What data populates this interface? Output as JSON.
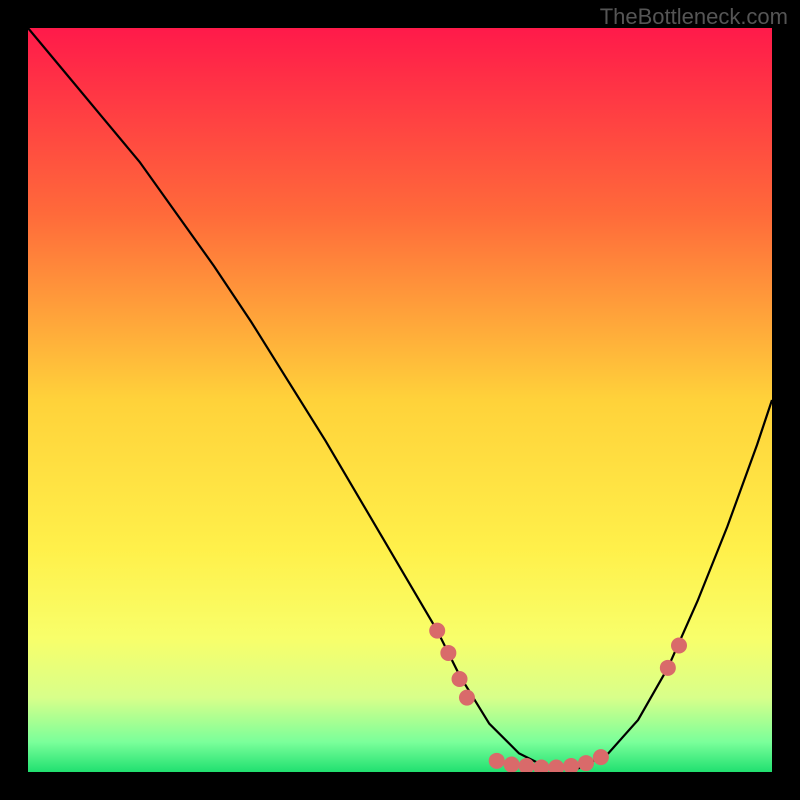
{
  "watermark": "TheBottleneck.com",
  "chart_data": {
    "type": "line",
    "title": "",
    "xlabel": "",
    "ylabel": "",
    "xlim": [
      0,
      100
    ],
    "ylim": [
      0,
      100
    ],
    "background_gradient": {
      "stops": [
        {
          "offset": 0,
          "color": "#ff1a4a"
        },
        {
          "offset": 0.25,
          "color": "#ff6a3a"
        },
        {
          "offset": 0.5,
          "color": "#ffd23a"
        },
        {
          "offset": 0.7,
          "color": "#fff04a"
        },
        {
          "offset": 0.82,
          "color": "#f8ff6a"
        },
        {
          "offset": 0.9,
          "color": "#d8ff8a"
        },
        {
          "offset": 0.96,
          "color": "#7aff9a"
        },
        {
          "offset": 1.0,
          "color": "#20e070"
        }
      ]
    },
    "series": [
      {
        "name": "bottleneck-curve",
        "x": [
          0,
          5,
          10,
          15,
          20,
          25,
          30,
          35,
          40,
          45,
          50,
          55,
          58,
          62,
          66,
          70,
          74,
          78,
          82,
          86,
          90,
          94,
          98,
          100
        ],
        "y": [
          100,
          94,
          88,
          82,
          75,
          68,
          60.5,
          52.5,
          44.5,
          36,
          27.5,
          19,
          13,
          6.5,
          2.5,
          0.5,
          0.5,
          2.5,
          7,
          14,
          23,
          33,
          44,
          50
        ]
      }
    ],
    "markers": {
      "name": "highlight-points",
      "color": "#d96a6a",
      "radius": 8,
      "points": [
        {
          "x": 55,
          "y": 19
        },
        {
          "x": 56.5,
          "y": 16
        },
        {
          "x": 58,
          "y": 12.5
        },
        {
          "x": 59,
          "y": 10
        },
        {
          "x": 63,
          "y": 1.5
        },
        {
          "x": 65,
          "y": 1
        },
        {
          "x": 67,
          "y": 0.8
        },
        {
          "x": 69,
          "y": 0.6
        },
        {
          "x": 71,
          "y": 0.6
        },
        {
          "x": 73,
          "y": 0.8
        },
        {
          "x": 75,
          "y": 1.2
        },
        {
          "x": 77,
          "y": 2
        },
        {
          "x": 86,
          "y": 14
        },
        {
          "x": 87.5,
          "y": 17
        }
      ]
    }
  }
}
